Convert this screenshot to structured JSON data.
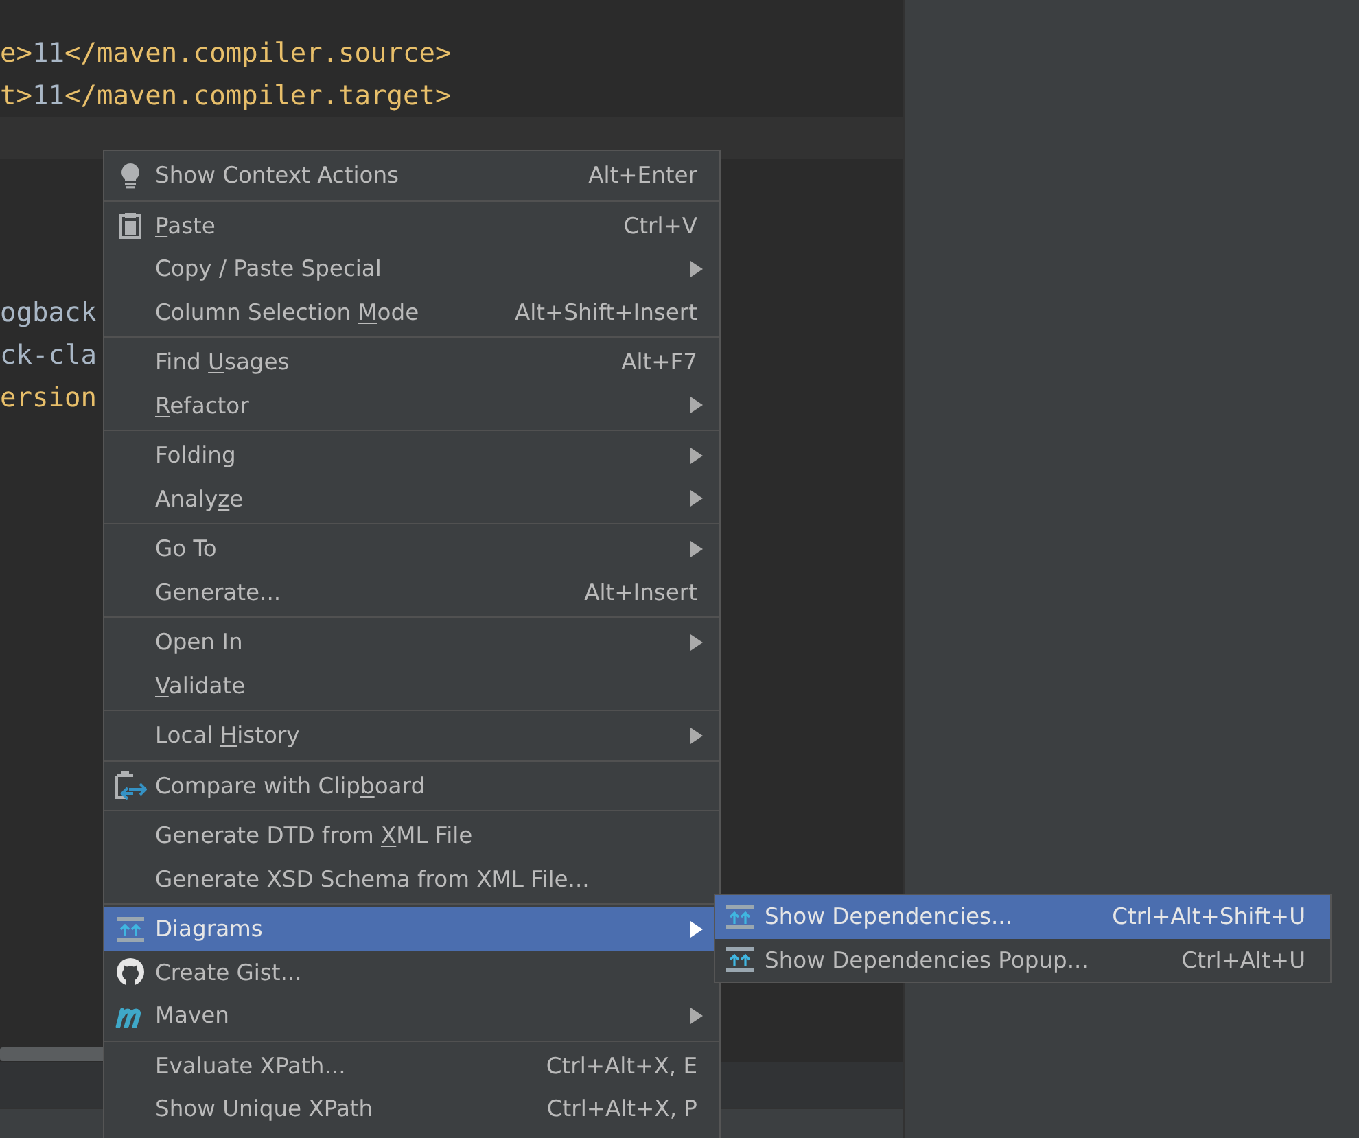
{
  "editor": {
    "lines_top": [
      {
        "segments": [
          {
            "kind": "tag",
            "text": "e>"
          },
          {
            "kind": "value",
            "text": "11"
          },
          {
            "kind": "tag",
            "text": "</maven.compiler.source>"
          }
        ]
      },
      {
        "segments": [
          {
            "kind": "tag",
            "text": "t>"
          },
          {
            "kind": "value",
            "text": "11"
          },
          {
            "kind": "tag",
            "text": "</maven.compiler.target>"
          }
        ]
      }
    ],
    "lines_bottom": [
      {
        "segments": [
          {
            "kind": "value",
            "text": "ogback"
          }
        ]
      },
      {
        "segments": [
          {
            "kind": "value",
            "text": "ck-cla"
          }
        ]
      },
      {
        "segments": [
          {
            "kind": "tag",
            "text": "ersion"
          }
        ]
      }
    ]
  },
  "context_menu": {
    "groups": [
      {
        "items": [
          {
            "label": "Show Context Actions",
            "shortcut": "Alt+Enter",
            "kind": "bulb",
            "has_submenu": false,
            "selected": false
          }
        ]
      },
      {
        "items": [
          {
            "mnemonic": "P",
            "label_after": "aste",
            "shortcut": "Ctrl+V",
            "kind": "clipboard",
            "has_submenu": false,
            "selected": false
          },
          {
            "label": "Copy / Paste Special",
            "has_submenu": true,
            "selected": false
          },
          {
            "label_before": "Column Selection ",
            "mnemonic": "M",
            "label_after": "ode",
            "shortcut": "Alt+Shift+Insert",
            "has_submenu": false,
            "selected": false
          }
        ]
      },
      {
        "items": [
          {
            "label_before": "Find ",
            "mnemonic": "U",
            "label_after": "sages",
            "shortcut": "Alt+F7",
            "has_submenu": false,
            "selected": false
          },
          {
            "mnemonic": "R",
            "label_after": "efactor",
            "has_submenu": true,
            "selected": false
          }
        ]
      },
      {
        "items": [
          {
            "label": "Folding",
            "has_submenu": true,
            "selected": false
          },
          {
            "label_before": "Analy",
            "mnemonic": "z",
            "label_after": "e",
            "has_submenu": true,
            "selected": false
          }
        ]
      },
      {
        "items": [
          {
            "label": "Go To",
            "has_submenu": true,
            "selected": false
          },
          {
            "label": "Generate...",
            "shortcut": "Alt+Insert",
            "has_submenu": false,
            "selected": false
          }
        ]
      },
      {
        "items": [
          {
            "label": "Open In",
            "has_submenu": true,
            "selected": false
          },
          {
            "mnemonic": "V",
            "label_after": "alidate",
            "has_submenu": false,
            "selected": false
          }
        ]
      },
      {
        "items": [
          {
            "label_before": "Local ",
            "mnemonic": "H",
            "label_after": "istory",
            "has_submenu": true,
            "selected": false
          }
        ]
      },
      {
        "items": [
          {
            "label_before": "Compare with Clip",
            "mnemonic": "b",
            "label_after": "oard",
            "kind": "compare",
            "has_submenu": false,
            "selected": false
          }
        ]
      },
      {
        "items": [
          {
            "label_before": "Generate DTD from ",
            "mnemonic": "X",
            "label_after": "ML File",
            "has_submenu": false,
            "selected": false
          },
          {
            "label": "Generate XSD Schema from XML File...",
            "has_submenu": false,
            "selected": false
          }
        ]
      },
      {
        "items": [
          {
            "label": "Diagrams",
            "kind": "diagram",
            "has_submenu": true,
            "selected": true
          },
          {
            "label": "Create Gist...",
            "kind": "github",
            "has_submenu": false,
            "selected": false
          },
          {
            "label": "Maven",
            "kind": "maven",
            "has_submenu": true,
            "selected": false
          }
        ]
      },
      {
        "items": [
          {
            "label": "Evaluate XPath...",
            "shortcut": "Ctrl+Alt+X, E",
            "has_submenu": false,
            "selected": false
          },
          {
            "label": "Show Unique XPath",
            "shortcut": "Ctrl+Alt+X, P",
            "has_submenu": false,
            "selected": false
          }
        ]
      }
    ]
  },
  "submenu": {
    "items": [
      {
        "label": "Show Dependencies...",
        "shortcut": "Ctrl+Alt+Shift+U",
        "kind": "diagram",
        "selected": true
      },
      {
        "label": "Show Dependencies Popup...",
        "shortcut": "Ctrl+Alt+U",
        "kind": "diagram",
        "selected": false
      }
    ]
  }
}
